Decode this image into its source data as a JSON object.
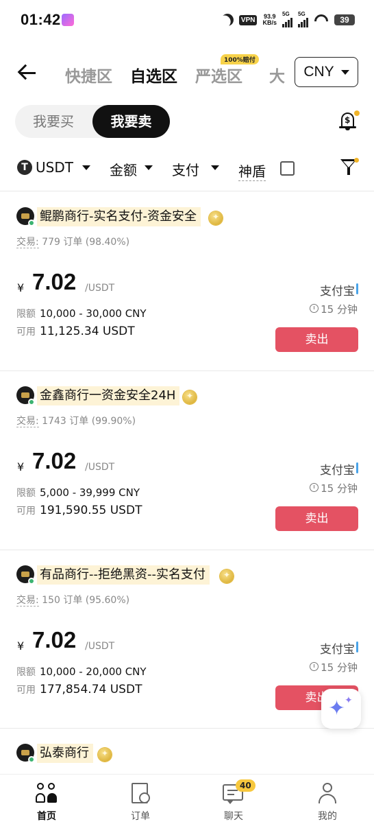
{
  "status_bar": {
    "time": "01:42",
    "vpn": "VPN",
    "speed_value": "93.9",
    "speed_unit": "KB/s",
    "sim1": "5G",
    "sim2": "5G",
    "battery": "39"
  },
  "header": {
    "tabs": [
      {
        "label": "快捷区",
        "active": false
      },
      {
        "label": "自选区",
        "active": true
      },
      {
        "label": "严选区",
        "active": false
      },
      {
        "label": "大",
        "active": false
      }
    ],
    "tab_badge": "100%赔付",
    "currency": "CNY"
  },
  "toggle": {
    "buy": "我要买",
    "sell": "我要卖",
    "selected": "sell"
  },
  "filters": {
    "coin": "USDT",
    "coin_icon": "T",
    "amount": "金额",
    "payment": "支付",
    "shield": "神盾",
    "shield_checked": false
  },
  "offers": [
    {
      "merchant": "鲲鹏商行-实名支付-资金安全",
      "trade_label": "交易:",
      "orders": "779 订单",
      "rate": "(98.40%)",
      "currency_symbol": "¥",
      "price": "7.02",
      "unit": "/USDT",
      "limit_label": "限额",
      "limit": "10,000 - 30,000 CNY",
      "available_label": "可用",
      "available": "11,125.34 USDT",
      "payment": "支付宝",
      "time": "15 分钟",
      "action": "卖出"
    },
    {
      "merchant": "金鑫商行一资金安全24H",
      "trade_label": "交易:",
      "orders": "1743 订单",
      "rate": "(99.90%)",
      "currency_symbol": "¥",
      "price": "7.02",
      "unit": "/USDT",
      "limit_label": "限额",
      "limit": "5,000 - 39,999 CNY",
      "available_label": "可用",
      "available": "191,590.55 USDT",
      "payment": "支付宝",
      "time": "15 分钟",
      "action": "卖出"
    },
    {
      "merchant": "有品商行--拒绝黑资--实名支付",
      "trade_label": "交易:",
      "orders": "150 订单",
      "rate": "(95.60%)",
      "currency_symbol": "¥",
      "price": "7.02",
      "unit": "/USDT",
      "limit_label": "限额",
      "limit": "10,000 - 20,000 CNY",
      "available_label": "可用",
      "available": "177,854.74 USDT",
      "payment": "支付宝",
      "time": "15 分钟",
      "action": "卖出"
    },
    {
      "merchant": "弘泰商行"
    }
  ],
  "bottom_nav": [
    {
      "label": "首页",
      "icon": "home-icon",
      "active": true
    },
    {
      "label": "订单",
      "icon": "order-icon",
      "active": false
    },
    {
      "label": "聊天",
      "icon": "chat-icon",
      "active": false,
      "badge": "40"
    },
    {
      "label": "我的",
      "icon": "profile-icon",
      "active": false
    }
  ],
  "colors": {
    "sell_button": "#e45263",
    "accent_yellow": "#f0b429",
    "online": "#3cb371",
    "merchant_highlight": "#fdf3d6"
  }
}
